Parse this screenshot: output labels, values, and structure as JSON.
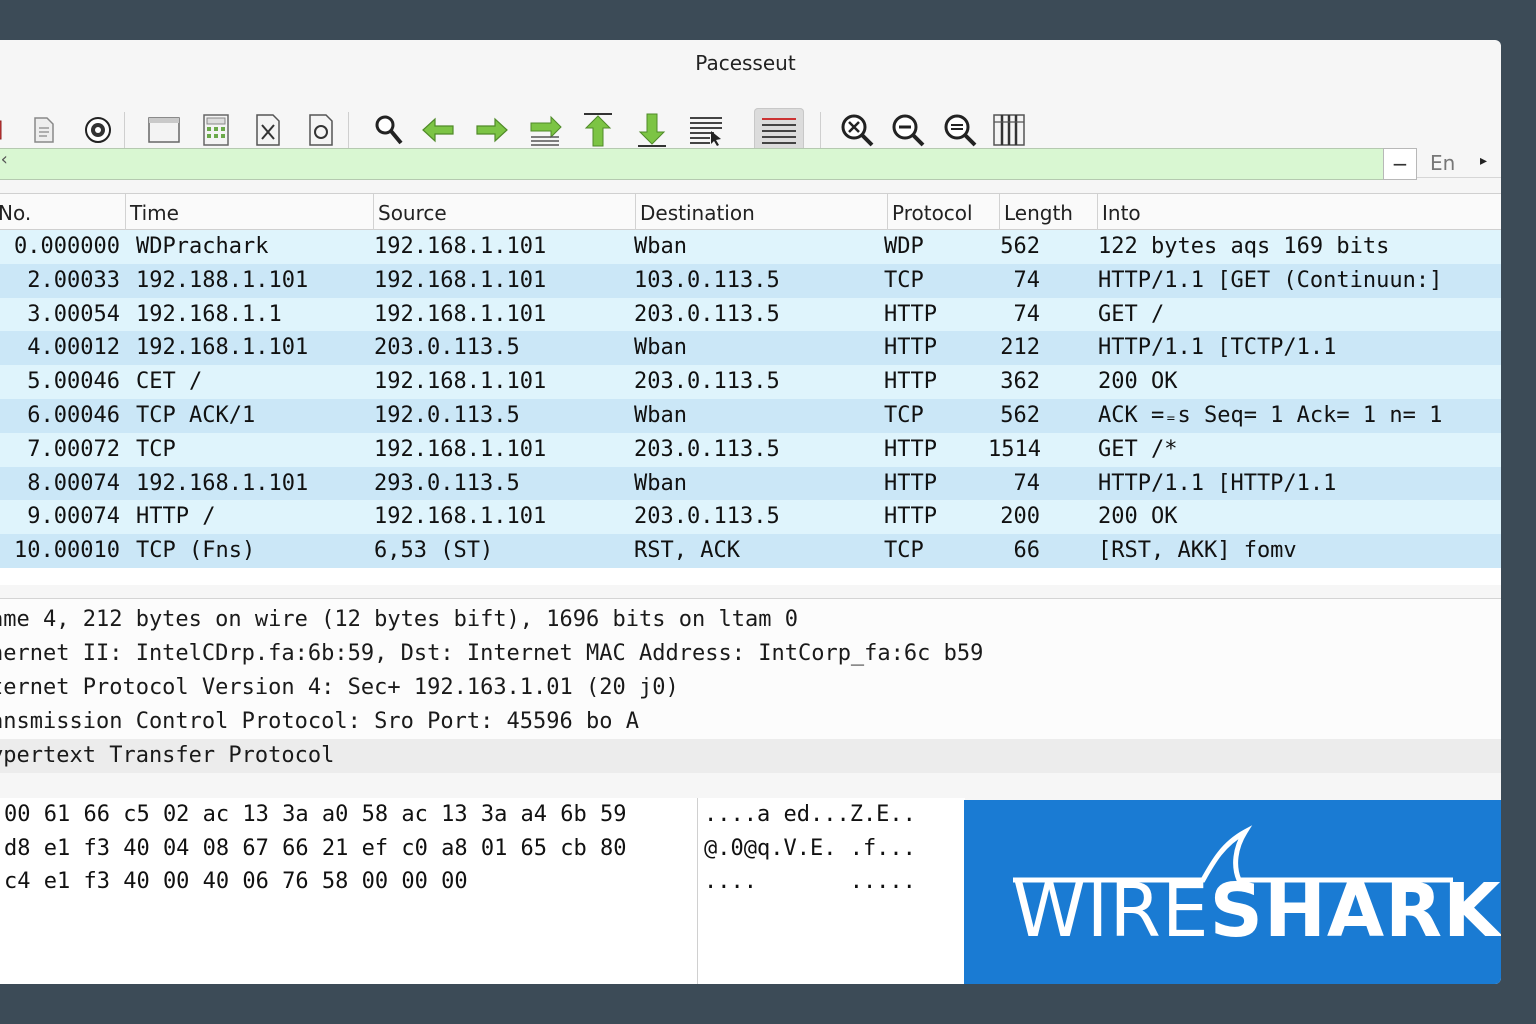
{
  "window": {
    "title": "Pacesseut"
  },
  "toolbar": {
    "buttons": [
      {
        "name": "stop-capture-icon"
      },
      {
        "name": "open-file-icon"
      },
      {
        "name": "capture-options-icon"
      },
      {
        "name": "window-icon"
      },
      {
        "name": "calculator-icon"
      },
      {
        "name": "close-file-icon"
      },
      {
        "name": "reload-file-icon"
      },
      {
        "name": "search-icon"
      },
      {
        "name": "go-back-icon"
      },
      {
        "name": "go-forward-icon"
      },
      {
        "name": "go-to-packet-icon"
      },
      {
        "name": "go-first-icon"
      },
      {
        "name": "go-last-icon"
      },
      {
        "name": "autoscroll-icon"
      },
      {
        "name": "colorize-icon"
      },
      {
        "name": "zoom-in-icon"
      },
      {
        "name": "zoom-out-icon"
      },
      {
        "name": "zoom-reset-icon"
      },
      {
        "name": "resize-columns-icon"
      }
    ]
  },
  "filter": {
    "value": "",
    "prefix": "‹",
    "clear_label": "−",
    "lang_label": "En",
    "arrow_label": "▸"
  },
  "packet_list": {
    "columns": [
      "No.",
      "Time",
      "Source",
      "Destination",
      "Protocol",
      "Length",
      "Into"
    ],
    "rows": [
      {
        "no": "0.000000",
        "time": "WDPrachark",
        "source": "192.168.1.101",
        "destination": "Wban",
        "protocol": "WDP",
        "length": "562",
        "info": "122 bytes aqs 169 bits"
      },
      {
        "no": "2.00033",
        "time": "192.188.1.101",
        "source": "192.168.1.101",
        "destination": "103.0.113.5",
        "protocol": "TCP",
        "length": "74",
        "info": "HTTP/1.1 [GET (Continuun:]"
      },
      {
        "no": "3.00054",
        "time": "192.168.1.1",
        "source": "192.168.1.101",
        "destination": "203.0.113.5",
        "protocol": "HTTP",
        "length": "74",
        "info": "GET /"
      },
      {
        "no": "4.00012",
        "time": "192.168.1.101",
        "source": "203.0.113.5",
        "destination": "Wban",
        "protocol": "HTTP",
        "length": "212",
        "info": "HTTP/1.1 [TCTP/1.1"
      },
      {
        "no": "5.00046",
        "time": "CET  /",
        "source": "192.168.1.101",
        "destination": "203.0.113.5",
        "protocol": "HTTP",
        "length": "362",
        "info": "200 OK"
      },
      {
        "no": "6.00046",
        "time": "TCP ACK/1",
        "source": "192.0.113.5",
        "destination": "Wban",
        "protocol": "TCP",
        "length": "562",
        "info": "ACK =₌s Seq= 1 Ack= 1 n= 1"
      },
      {
        "no": "7.00072",
        "time": "TCP",
        "source": "192.168.1.101",
        "destination": "203.0.113.5",
        "protocol": "HTTP",
        "length": "1514",
        "info": "GET /*"
      },
      {
        "no": "8.00074",
        "time": "192.168.1.101",
        "source": "293.0.113.5",
        "destination": "Wban",
        "protocol": "HTTP",
        "length": "74",
        "info": "HTTP/1.1 [HTTP/1.1"
      },
      {
        "no": "9.00074",
        "time": "HTTP /",
        "source": "192.168.1.101",
        "destination": "203.0.113.5",
        "protocol": "HTTP",
        "length": "200",
        "info": "200 OK"
      },
      {
        "no": "10.00010",
        "time": "TCP (Fns)",
        "source": "6,53 (ST)",
        "destination": "RST, ACK",
        "protocol": "TCP",
        "length": "66",
        "info": "[RST, AKK] fomv"
      }
    ]
  },
  "details": {
    "lines": [
      "ame 4, 212 bytes on wire (12 bytes bift), 1696 bits on ltam 0",
      "hernet II: IntelCDrp.fa:6b:59, Dst: Internet MAC Address: IntCorp_fa:6c b59",
      "ternet Protocol Version 4: Sec+ 192.163.1.01 (20 j0)",
      "ansmission Control Protocol: Sro Port: 45596 bo A",
      "ypertext Transfer Protocol"
    ]
  },
  "bytes": {
    "hex": [
      "00 61 66 c5 02 ac 13 3a a0 58 ac 13 3a a4 6b 59",
      "d8 e1 f3 40 04 08 67 66 21 ef c0 a8 01 65 cb 80",
      "c4 e1 f3 40 00 40 06 76 58 00 00 00"
    ],
    "ascii": [
      "....a ed...Z.E..",
      "@.0@q.V.E. .f...",
      "....       ....."
    ]
  },
  "logo": {
    "part1": "WIRE",
    "part2": "SHARK"
  },
  "colors": {
    "row_odd": "#dff4fc",
    "row_even": "#cbe7f7",
    "filter_bg": "#d9f7d2",
    "logo_bg": "#1a7bd3"
  }
}
